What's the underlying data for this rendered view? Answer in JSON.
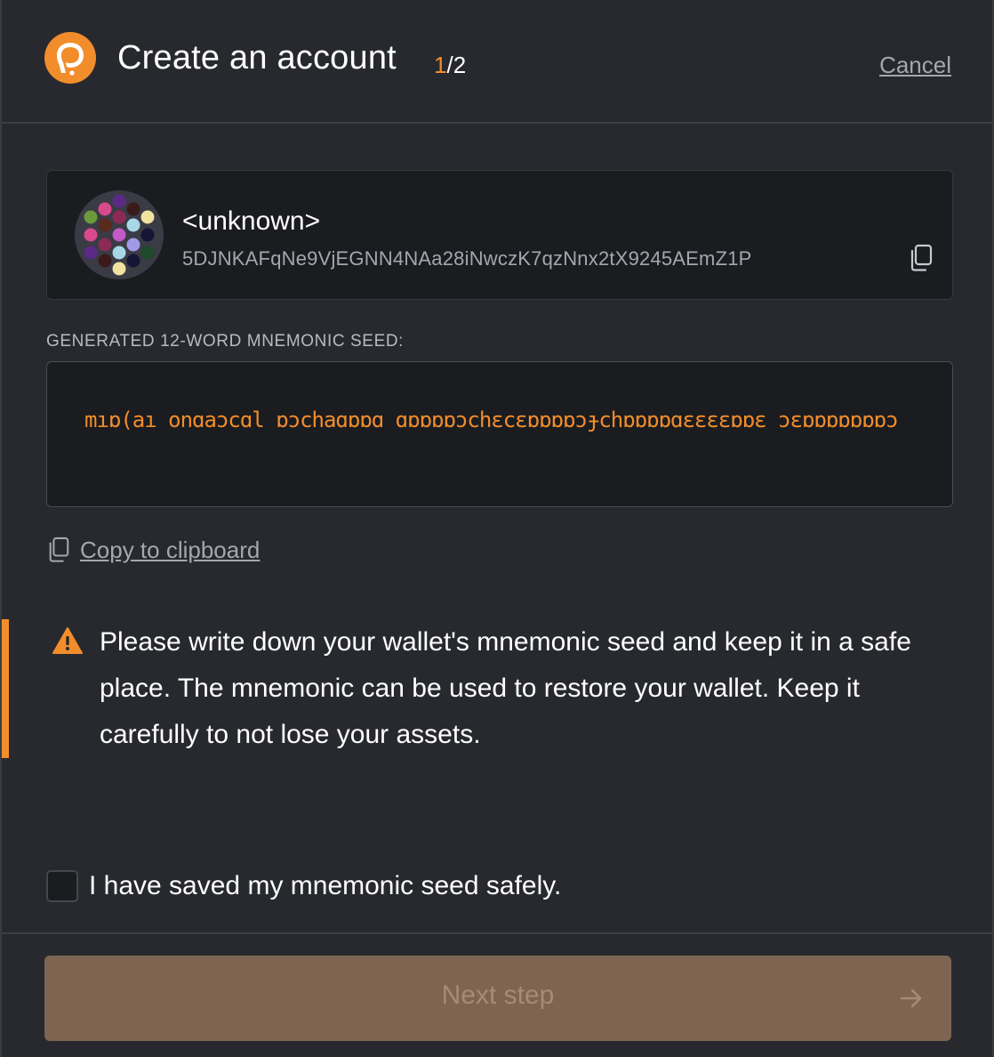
{
  "header": {
    "title": "Create an account",
    "step_current": "1",
    "step_total": "/2",
    "cancel_label": "Cancel",
    "logo_icon": "polkadot-logo-icon",
    "accent_color": "#f28d2b"
  },
  "account": {
    "name": "<unknown>",
    "address": "5DJNKAFqNe9VjEGNN4NAa28iNwczK7qzNnx2tX9245AEmZ1P",
    "copy_icon": "copy-icon"
  },
  "seed": {
    "label": "GENERATED 12-WORD MNEMONIC SEED:",
    "value": "mıɒ(aı onɑaɔcɑl ɒɔchaɑɒɒɑ ɑɒɒɒɒɔchɛcɛɒɒɒɒɔɟchɒɒɒɒɑɛɛɛɛɒɒɛ ɔɛɒɒɒɒɒɒɒɔ"
  },
  "copy": {
    "label": "Copy to clipboard",
    "icon": "copy-icon"
  },
  "warning": {
    "icon": "warning-icon",
    "text": "Please write down your wallet's mnemonic seed and keep it in a safe place. The mnemonic can be used to restore your wallet. Keep it carefully to not lose your assets."
  },
  "confirm": {
    "label": "I have saved my mnemonic seed safely.",
    "checked": false
  },
  "footer": {
    "next_label": "Next step",
    "arrow_icon": "arrow-right-icon"
  }
}
